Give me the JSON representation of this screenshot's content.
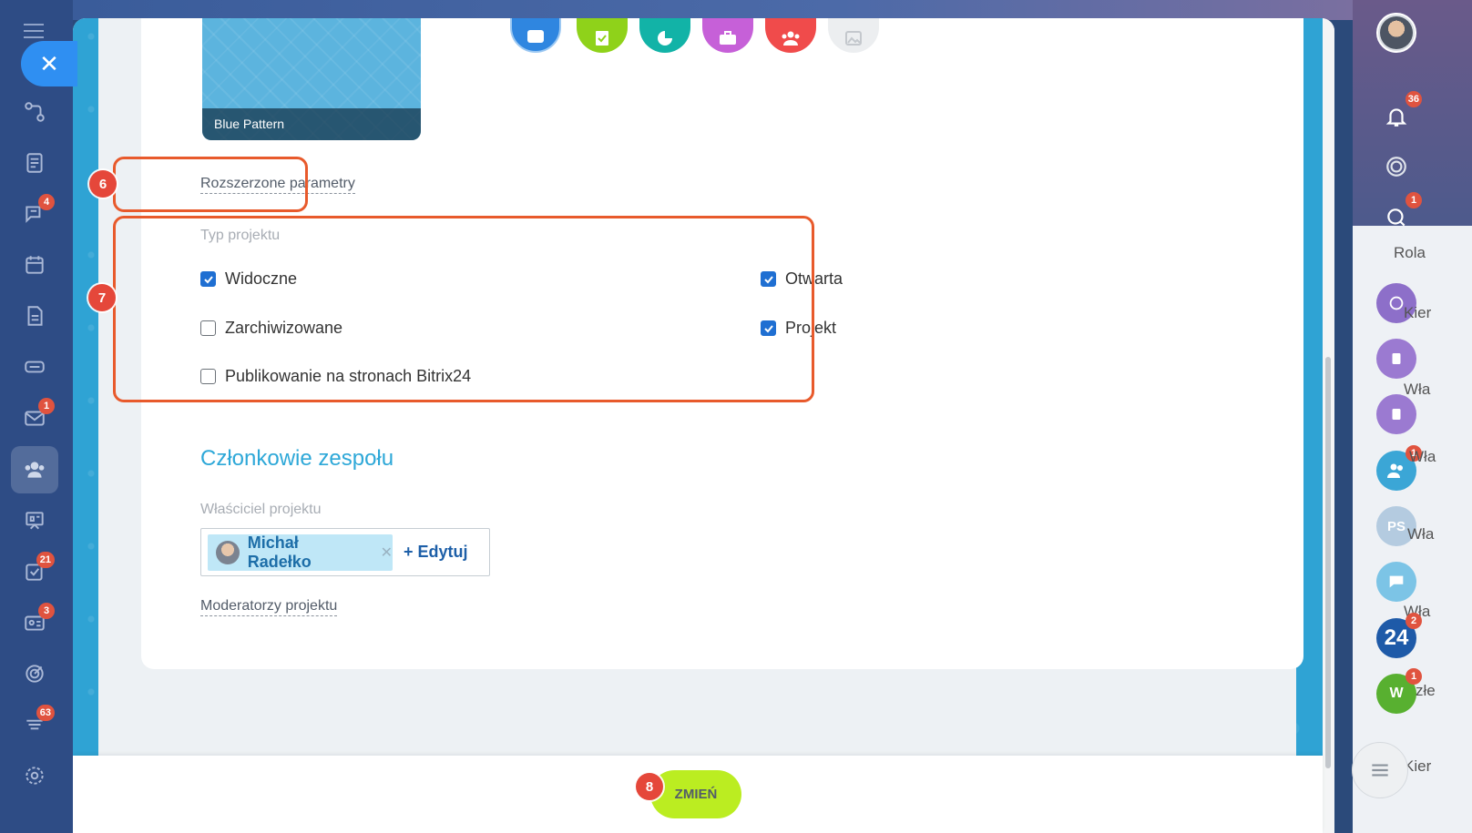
{
  "theme": {
    "name": "Blue Pattern"
  },
  "advanced_link": "Rozszerzone parametry",
  "project_type": {
    "label": "Typ projektu",
    "options": [
      {
        "label": "Widoczne",
        "checked": true
      },
      {
        "label": "Zarchiwizowane",
        "checked": false
      },
      {
        "label": "Publikowanie na stronach Bitrix24",
        "checked": false
      },
      {
        "label": "Otwarta",
        "checked": true
      },
      {
        "label": "Projekt",
        "checked": true
      }
    ]
  },
  "team": {
    "title": "Członkowie zespołu",
    "owner_label": "Właściciel projektu",
    "owner_name": "Michał Radełko",
    "edit_label": "+ Edytuj",
    "moderators_label": "Moderatorzy projektu"
  },
  "footer": {
    "submit_label": "ZMIEŃ"
  },
  "annotations": {
    "a6": "6",
    "a7": "7",
    "a8": "8"
  },
  "left_nav": {
    "badges": {
      "chat": "4",
      "mail": "1",
      "tasks": "21",
      "crm": "3",
      "feed": "63"
    }
  },
  "right_bar": {
    "badges": {
      "notifications": "36",
      "activity": "1",
      "group": "1",
      "b24": "2",
      "w": "1"
    },
    "ps_label": "PS",
    "b24_label": "24",
    "w_label": "W",
    "bg_texts": {
      "rola": "Rola",
      "kier1": "Kier",
      "wla1": "Wła",
      "wla2": "Wła",
      "wla3": "Wła",
      "wla4": "Wła",
      "zlo": "złe",
      "kier2": "Kier"
    }
  },
  "colors": {
    "accent": "#2ea8d8",
    "button": "#bbed21",
    "annotation": "#e85a2c",
    "checkbox": "#1f6fd2"
  }
}
